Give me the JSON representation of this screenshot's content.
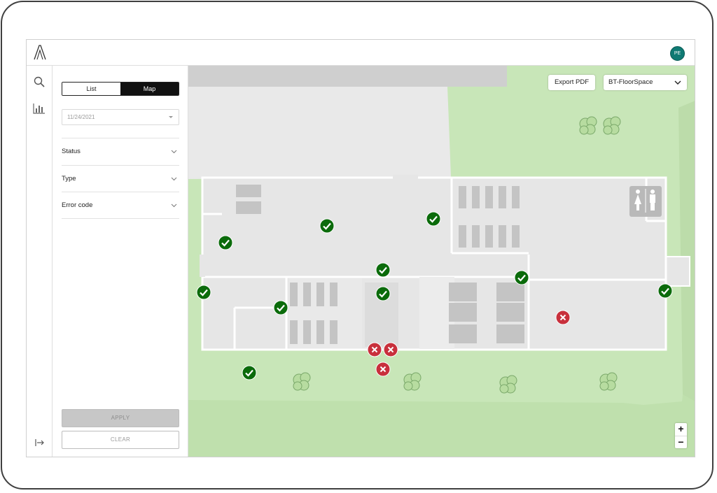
{
  "header": {
    "logo_icon": "brand-logo-icon",
    "avatar_initials": "PE",
    "avatar_color": "#0f7a73"
  },
  "rail": {
    "items": [
      {
        "name": "search-icon"
      },
      {
        "name": "bar-chart-icon"
      }
    ],
    "collapse_icon": "collapse-arrow-icon"
  },
  "panel": {
    "view_toggle": {
      "list_label": "List",
      "map_label": "Map",
      "selected": "Map"
    },
    "date": {
      "value": "11/24/2021"
    },
    "filters": [
      {
        "label": "Status"
      },
      {
        "label": "Type"
      },
      {
        "label": "Error code"
      }
    ],
    "apply_label": "APPLY",
    "clear_label": "CLEAR"
  },
  "map": {
    "export_label": "Export PDF",
    "floor_selected": "BT-FloorSpace",
    "zoom_in_label": "+",
    "zoom_out_label": "−",
    "colors": {
      "ok": "#0b6b0b",
      "error": "#c8303c",
      "grass": "#c6e5b4",
      "building": "#e6e6e6"
    }
  }
}
